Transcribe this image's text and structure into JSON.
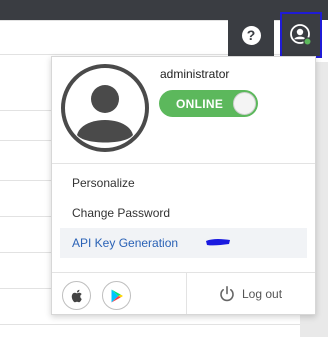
{
  "header": {
    "help_icon_glyph": "?"
  },
  "user_menu": {
    "username": "administrator",
    "status_label": "ONLINE",
    "status_color": "#5cb85c",
    "items": [
      {
        "label": "Personalize"
      },
      {
        "label": "Change Password"
      },
      {
        "label": "API Key Generation"
      }
    ],
    "app_store_icons": [
      "apple-icon",
      "google-play-icon"
    ],
    "logout_label": "Log out"
  },
  "colors": {
    "topbar": "#3a3d42",
    "accent_link": "#2a62b6",
    "highlight_border": "#1f1bd6"
  }
}
